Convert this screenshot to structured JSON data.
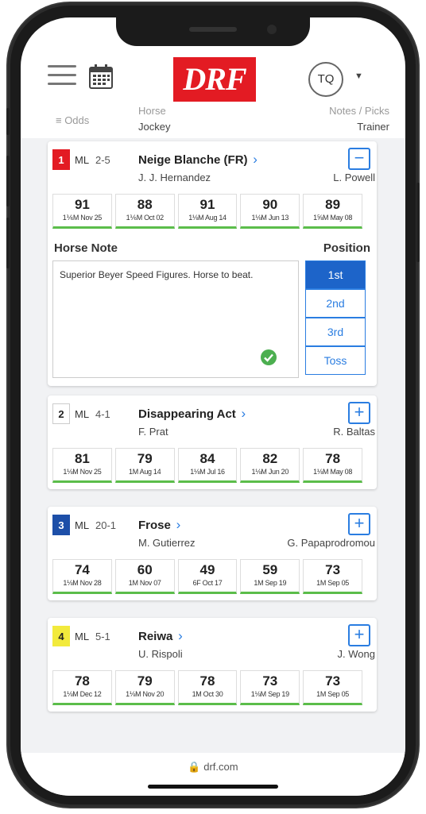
{
  "header": {
    "logo_text": "DRF",
    "avatar_initials": "TQ"
  },
  "columns": {
    "odds": "≡ Odds",
    "horse": "Horse",
    "jockey": "Jockey",
    "notes": "Notes / Picks",
    "trainer": "Trainer"
  },
  "colors": {
    "accent": "#2a7de1",
    "logo": "#e31b23",
    "fig_underline": "#5bbd4a"
  },
  "entries": [
    {
      "pp": "1",
      "pp_color": "#e31b23",
      "pp_text": "#ffffff",
      "ml_label": "ML",
      "ml": "2-5",
      "horse": "Neige Blanche (FR)",
      "jockey": "J. J. Hernandez",
      "trainer": "L. Powell",
      "toggle": "−",
      "figs": [
        {
          "num": "91",
          "race": "1⅙M Nov 25"
        },
        {
          "num": "88",
          "race": "1⅙M Oct 02"
        },
        {
          "num": "91",
          "race": "1⅛M Aug 14"
        },
        {
          "num": "90",
          "race": "1⅛M Jun 13"
        },
        {
          "num": "89",
          "race": "1⅝M May 08"
        }
      ]
    },
    {
      "pp": "2",
      "pp_color": "#ffffff",
      "pp_text": "#222222",
      "ml_label": "ML",
      "ml": "4-1",
      "horse": "Disappearing Act",
      "jockey": "F. Prat",
      "trainer": "R. Baltas",
      "toggle": "+",
      "figs": [
        {
          "num": "81",
          "race": "1⅛M Nov 25"
        },
        {
          "num": "79",
          "race": "1M Aug 14"
        },
        {
          "num": "84",
          "race": "1⅛M Jul 16"
        },
        {
          "num": "82",
          "race": "1⅛M Jun 20"
        },
        {
          "num": "78",
          "race": "1⅛M May 08"
        }
      ]
    },
    {
      "pp": "3",
      "pp_color": "#1d4fa8",
      "pp_text": "#ffffff",
      "ml_label": "ML",
      "ml": "20-1",
      "horse": "Frose",
      "jockey": "M. Gutierrez",
      "trainer": "G. Papaprodromou",
      "toggle": "+",
      "figs": [
        {
          "num": "74",
          "race": "1⅛M Nov 28"
        },
        {
          "num": "60",
          "race": "1M Nov 07"
        },
        {
          "num": "49",
          "race": "6F Oct 17"
        },
        {
          "num": "59",
          "race": "1M Sep 19"
        },
        {
          "num": "73",
          "race": "1M Sep 05"
        }
      ]
    },
    {
      "pp": "4",
      "pp_color": "#f2ea3c",
      "pp_text": "#222222",
      "ml_label": "ML",
      "ml": "5-1",
      "horse": "Reiwa",
      "jockey": "U. Rispoli",
      "trainer": "J. Wong",
      "toggle": "+",
      "figs": [
        {
          "num": "78",
          "race": "1⅛M Dec 12"
        },
        {
          "num": "79",
          "race": "1⅛M Nov 20"
        },
        {
          "num": "78",
          "race": "1M Oct 30"
        },
        {
          "num": "73",
          "race": "1⅛M Sep 19"
        },
        {
          "num": "73",
          "race": "1M Sep 05"
        }
      ]
    }
  ],
  "note": {
    "title": "Horse Note",
    "text": "Superior Beyer Speed Figures. Horse to beat.",
    "position_title": "Position",
    "positions": [
      "1st",
      "2nd",
      "3rd",
      "Toss"
    ],
    "selected_position": "1st"
  },
  "footer": {
    "url": "🔒 drf.com"
  }
}
